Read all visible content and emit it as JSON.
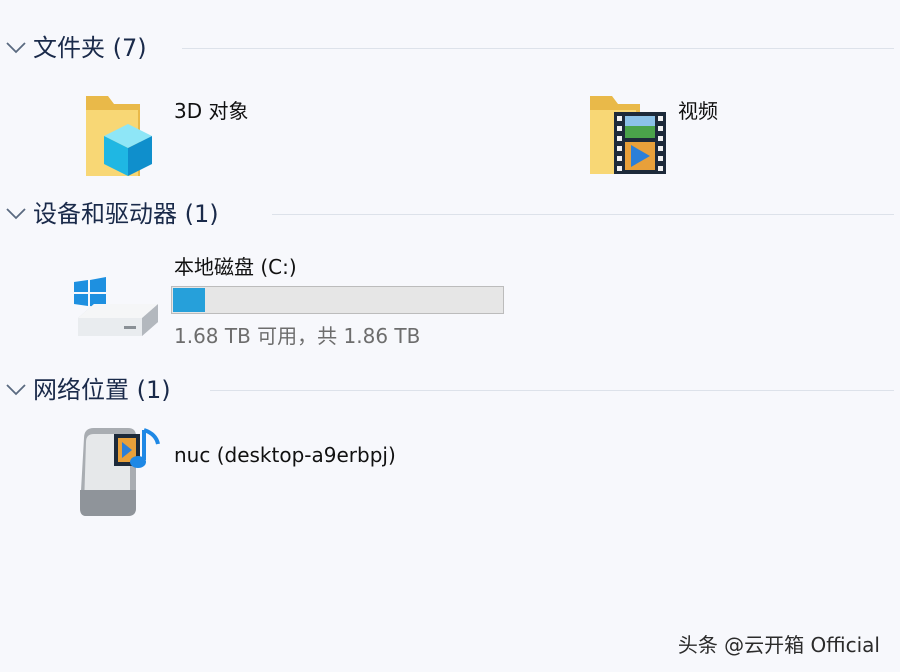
{
  "groups": [
    {
      "title": "文件夹 (7)"
    },
    {
      "title": "设备和驱动器 (1)"
    },
    {
      "title": "网络位置 (1)"
    }
  ],
  "folders": [
    {
      "label": "3D 对象",
      "icon": "3d-objects-folder-icon"
    },
    {
      "label": "视频",
      "icon": "videos-folder-icon"
    }
  ],
  "drive": {
    "label": "本地磁盘 (C:)",
    "icon": "windows-drive-icon",
    "used_fraction": 0.097,
    "info": "1.68 TB 可用，共 1.86 TB"
  },
  "network": {
    "label": "nuc (desktop-a9erbpj)",
    "icon": "media-server-icon"
  },
  "watermark": "头条 @云开箱 Official",
  "colors": {
    "background": "#f7f8fc",
    "drive_bar_fill": "#26a0da",
    "folder_yellow": "#f5cf5b"
  }
}
